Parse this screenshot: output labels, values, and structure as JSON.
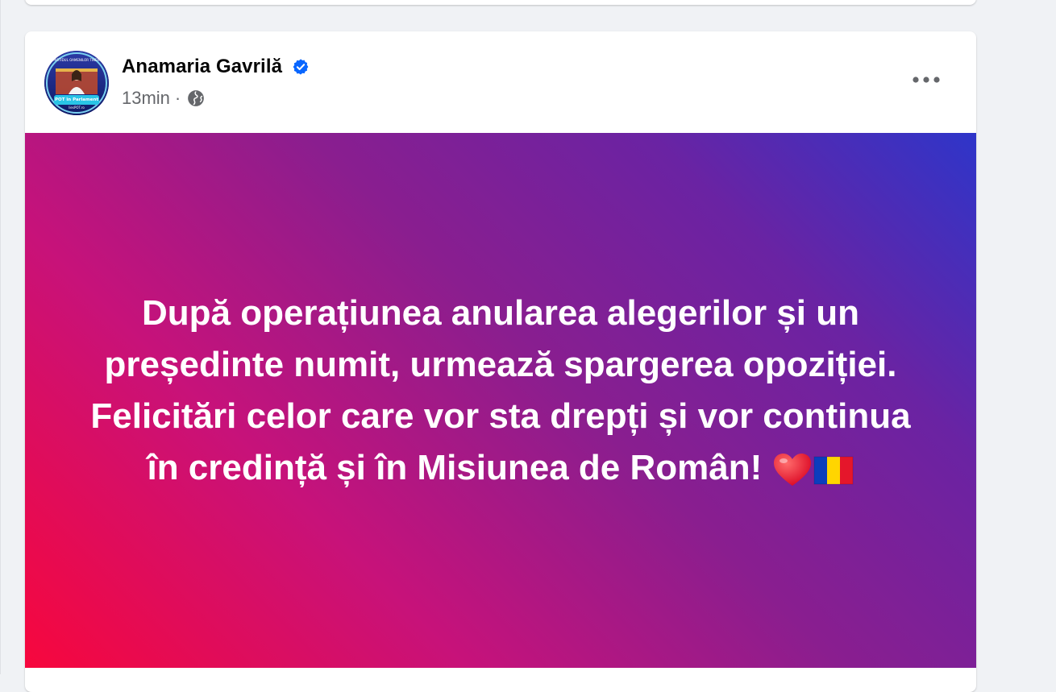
{
  "post": {
    "author": "Anamaria Gavrilă",
    "time": "13min",
    "separator": "·",
    "verified_icon": "verified-badge-icon",
    "audience_icon": "globe-icon",
    "more_icon": "more-options-icon",
    "text": "După operațiunea anularea alegerilor și un președinte numit, urmează spargerea opoziției. Felicitări celor care vor sta drepți și vor continua în credință și în Misiunea de Român!",
    "emojis": [
      "heart-emoji",
      "romania-flag-emoji"
    ],
    "avatar_lines": [
      "PARTIDUL OAMENILOR TINERI",
      "POT în Parlament",
      "liesPOT.ro"
    ]
  },
  "colors": {
    "verified_blue": "#0866ff",
    "gradient_start": "#f7073d",
    "gradient_end": "#2e35c9"
  }
}
